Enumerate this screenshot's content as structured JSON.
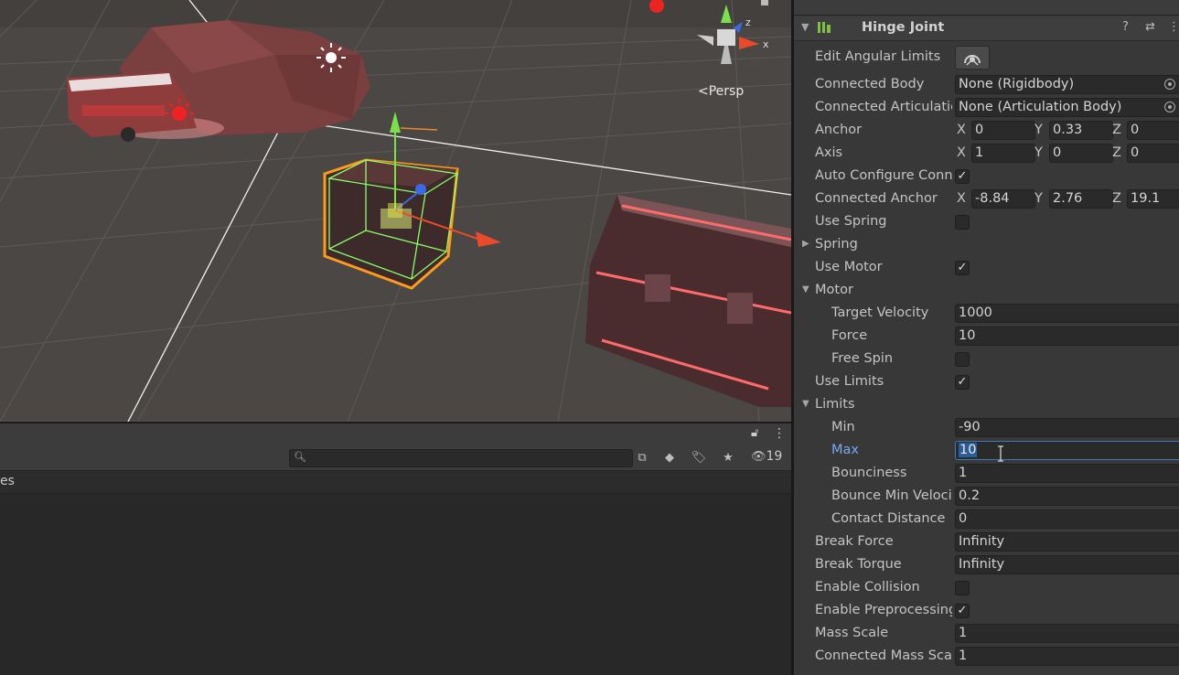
{
  "scene": {
    "view_mode": "Persp",
    "gizmo_axes": [
      "y",
      "z",
      "x"
    ]
  },
  "bottom_panel": {
    "hidden_count": "19",
    "search_placeholder": "",
    "list_header_fragment": "es"
  },
  "component": {
    "title": "Hinge Joint",
    "edit_angular_limits_label": "Edit Angular Limits",
    "fields": {
      "connected_body": {
        "label": "Connected Body",
        "value": "None (Rigidbody)"
      },
      "connected_articulation": {
        "label": "Connected Articulation Body",
        "value": "None (Articulation Body)"
      },
      "anchor": {
        "label": "Anchor",
        "x": "0",
        "y": "0.33",
        "z": "0"
      },
      "axis": {
        "label": "Axis",
        "x": "1",
        "y": "0",
        "z": "0"
      },
      "auto_configure": {
        "label": "Auto Configure Connected Anchor",
        "checked": true
      },
      "connected_anchor": {
        "label": "Connected Anchor",
        "x": "-8.84",
        "y": "2.76",
        "z": "19.1"
      },
      "use_spring": {
        "label": "Use Spring",
        "checked": false
      },
      "spring": {
        "label": "Spring"
      },
      "use_motor": {
        "label": "Use Motor",
        "checked": true
      },
      "motor": {
        "label": "Motor"
      },
      "target_velocity": {
        "label": "Target Velocity",
        "value": "1000"
      },
      "force": {
        "label": "Force",
        "value": "10"
      },
      "free_spin": {
        "label": "Free Spin",
        "checked": false
      },
      "use_limits": {
        "label": "Use Limits",
        "checked": true
      },
      "limits": {
        "label": "Limits"
      },
      "min": {
        "label": "Min",
        "value": "-90"
      },
      "max": {
        "label": "Max",
        "value": "10"
      },
      "bounciness": {
        "label": "Bounciness",
        "value": "1"
      },
      "bounce_min_velocity": {
        "label": "Bounce Min Velocity",
        "value": "0.2"
      },
      "contact_distance": {
        "label": "Contact Distance",
        "value": "0"
      },
      "break_force": {
        "label": "Break Force",
        "value": "Infinity"
      },
      "break_torque": {
        "label": "Break Torque",
        "value": "Infinity"
      },
      "enable_collision": {
        "label": "Enable Collision",
        "checked": false
      },
      "enable_preprocessing": {
        "label": "Enable Preprocessing",
        "checked": true
      },
      "mass_scale": {
        "label": "Mass Scale",
        "value": "1"
      },
      "connected_mass_scale": {
        "label": "Connected Mass Scale",
        "value": "1"
      }
    },
    "axis_labels": {
      "x": "X",
      "y": "Y",
      "z": "Z"
    },
    "check_mark": "✓"
  },
  "colors": {
    "accent_active": "#7ba8f0",
    "field_bg": "#2a2a2a",
    "selection": "#2c5d96"
  }
}
